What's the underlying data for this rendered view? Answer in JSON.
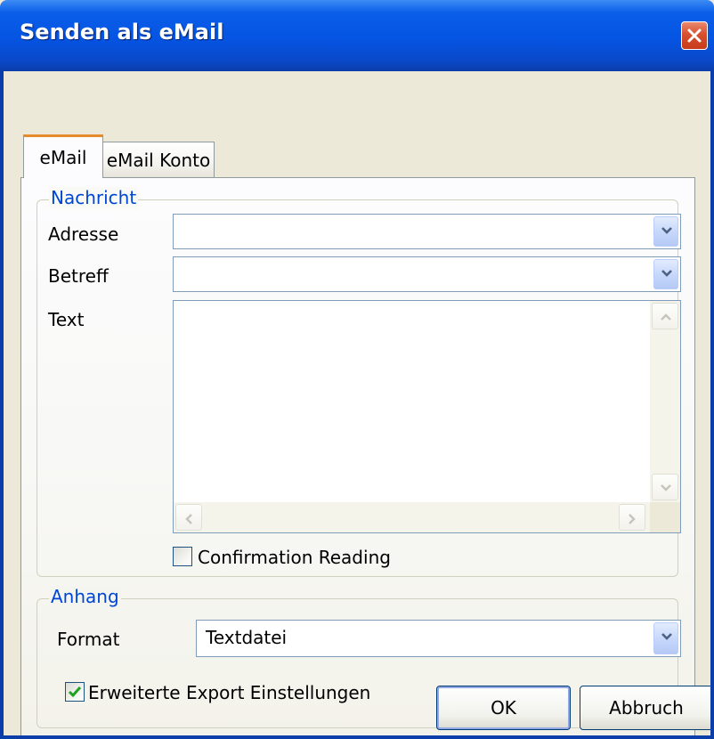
{
  "window": {
    "title": "Senden als eMail"
  },
  "tabs": [
    {
      "label": "eMail",
      "active": true
    },
    {
      "label": "eMail Konto",
      "active": false
    }
  ],
  "message": {
    "group_label": "Nachricht",
    "address_label": "Adresse",
    "address_value": "",
    "subject_label": "Betreff",
    "subject_value": "",
    "text_label": "Text",
    "text_value": "",
    "read_confirmation_label": "Confirmation Reading",
    "read_confirmation_checked": false
  },
  "attachment": {
    "group_label": "Anhang",
    "format_label": "Format",
    "format_value": "Textdatei",
    "extended_export_label": "Erweiterte Export Einstellungen",
    "extended_export_checked": true
  },
  "buttons": {
    "ok": "OK",
    "cancel": "Abbruch"
  },
  "colors": {
    "titlebar": "#0554e3",
    "legend_text": "#0046d5",
    "dialog_bg": "#ece9d8",
    "close_button": "#d9502e",
    "checkmark": "#21a121"
  },
  "icons": [
    "close-icon",
    "chevron-down-icon",
    "scroll-up-icon",
    "scroll-down-icon",
    "scroll-left-icon",
    "scroll-right-icon",
    "checkmark-icon"
  ]
}
